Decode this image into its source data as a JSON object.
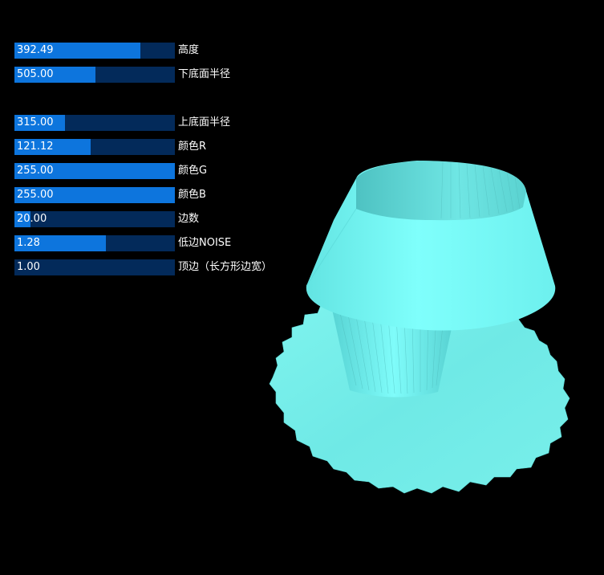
{
  "sliders": [
    {
      "value": "392.49",
      "label": "高度",
      "fill": 0.785
    },
    {
      "value": "505.00",
      "label": "下底面半径",
      "fill": 0.505
    },
    {
      "value": "315.00",
      "label": "上底面半径",
      "fill": 0.315
    },
    {
      "value": "121.12",
      "label": "颜色R",
      "fill": 0.475
    },
    {
      "value": "255.00",
      "label": "颜色G",
      "fill": 1.0
    },
    {
      "value": "255.00",
      "label": "颜色B",
      "fill": 1.0
    },
    {
      "value": "20.00",
      "label": "边数",
      "fill": 0.1
    },
    {
      "value": "1.28",
      "label": "低边NOISE",
      "fill": 0.57
    },
    {
      "value": "1.00",
      "label": "顶边（长方形边宽）",
      "fill": 0.0
    }
  ],
  "colors": {
    "track": "#032a5a",
    "fill": "#0d75dd",
    "model": "#79ffff",
    "background": "#000000"
  }
}
